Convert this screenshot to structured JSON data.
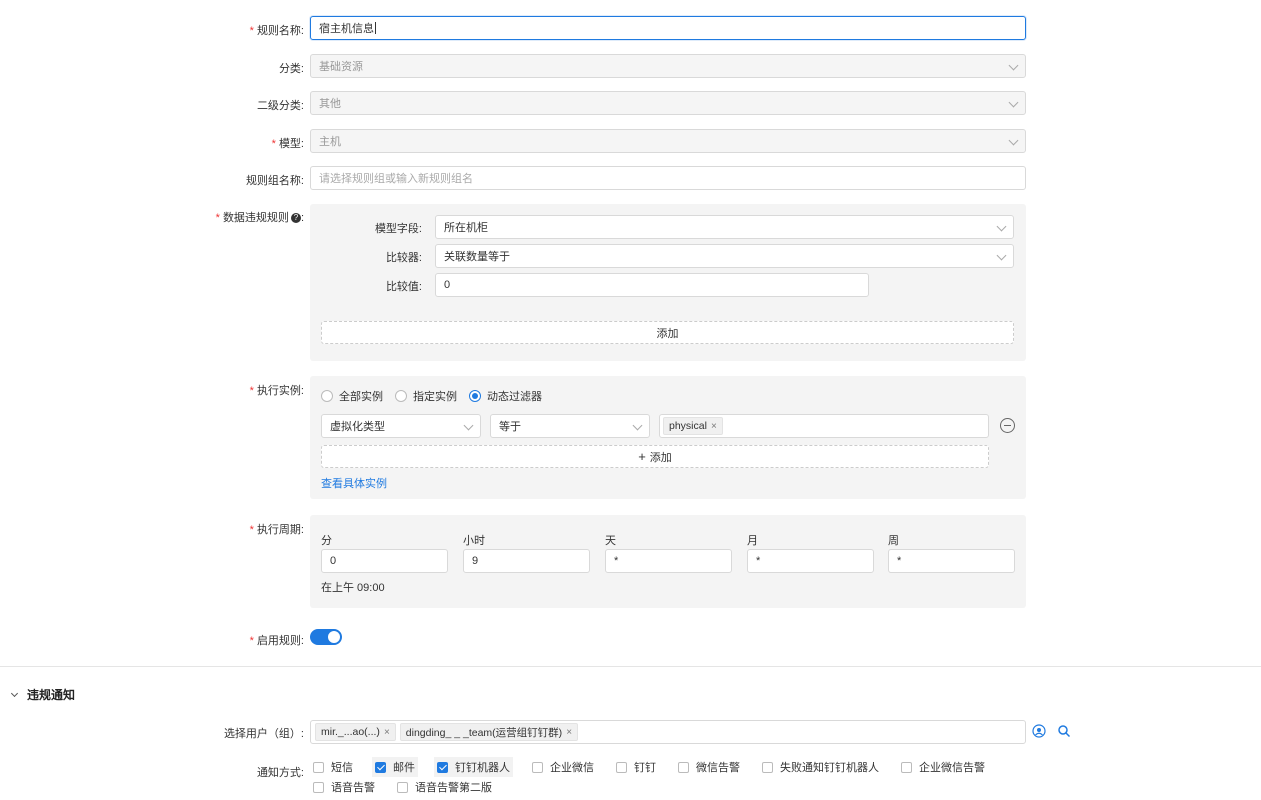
{
  "form": {
    "rule_name": {
      "label": "规则名称:",
      "value": "宿主机信息"
    },
    "category": {
      "label": "分类:",
      "value": "基础资源"
    },
    "sub_category": {
      "label": "二级分类:",
      "value": "其他"
    },
    "model": {
      "label": "模型:",
      "value": "主机"
    },
    "rule_group": {
      "label": "规则组名称:",
      "placeholder": "请选择规则组或输入新规则组名"
    },
    "violation_rule": {
      "label": "数据违规规则",
      "field_label": "模型字段:",
      "field_value": "所在机柜",
      "comparator_label": "比较器:",
      "comparator_value": "关联数量等于",
      "compare_value_label": "比较值:",
      "compare_value": "0",
      "add_label": "添加"
    },
    "exec_instance": {
      "label": "执行实例:",
      "options": [
        "全部实例",
        "指定实例",
        "动态过滤器"
      ],
      "filter_field": "虚拟化类型",
      "filter_op": "等于",
      "filter_tag": "physical",
      "add_label": "添加",
      "view_link": "查看具体实例"
    },
    "schedule": {
      "label": "执行周期:",
      "columns": [
        {
          "label": "分",
          "value": "0"
        },
        {
          "label": "小时",
          "value": "9"
        },
        {
          "label": "天",
          "value": "*"
        },
        {
          "label": "月",
          "value": "*"
        },
        {
          "label": "周",
          "value": "*"
        }
      ],
      "summary": "在上午 09:00"
    },
    "enable": {
      "label": "启用规则:",
      "on": true
    }
  },
  "notify": {
    "title": "违规通知",
    "users_label": "选择用户（组）:",
    "user_tags": [
      "mir._...ao(...)",
      "dingding_ _ _team(运营组钉钉群)"
    ],
    "method_label": "通知方式:",
    "methods": [
      {
        "label": "短信",
        "checked": false
      },
      {
        "label": "邮件",
        "checked": true
      },
      {
        "label": "钉钉机器人",
        "checked": true
      },
      {
        "label": "企业微信",
        "checked": false
      },
      {
        "label": "钉钉",
        "checked": false
      },
      {
        "label": "微信告警",
        "checked": false
      },
      {
        "label": "失败通知钉钉机器人",
        "checked": false
      },
      {
        "label": "企业微信告警",
        "checked": false
      },
      {
        "label": "语音告警",
        "checked": false
      },
      {
        "label": "语音告警第二版",
        "checked": false
      }
    ]
  },
  "colors": {
    "accent": "#1f7ae0",
    "required": "#e33333"
  }
}
